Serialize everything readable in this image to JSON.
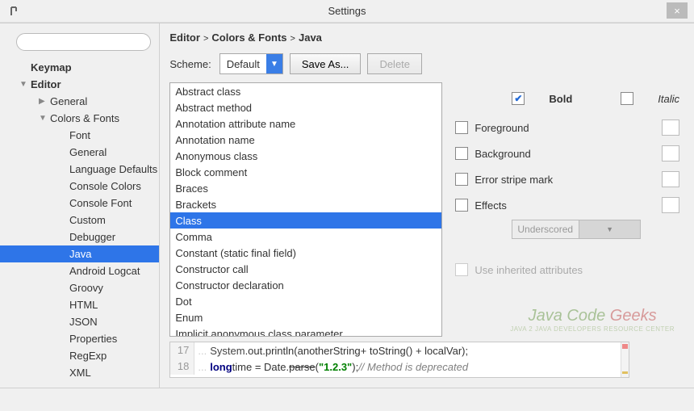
{
  "window": {
    "title": "Settings"
  },
  "search": {
    "placeholder": ""
  },
  "tree": [
    {
      "label": "Keymap",
      "level": 1,
      "bold": true,
      "caret": ""
    },
    {
      "label": "Editor",
      "level": 1,
      "bold": true,
      "caret": "▼"
    },
    {
      "label": "General",
      "level": 2,
      "caret": "▶"
    },
    {
      "label": "Colors & Fonts",
      "level": 2,
      "caret": "▼"
    },
    {
      "label": "Font",
      "level": 3
    },
    {
      "label": "General",
      "level": 3
    },
    {
      "label": "Language Defaults",
      "level": 3
    },
    {
      "label": "Console Colors",
      "level": 3
    },
    {
      "label": "Console Font",
      "level": 3
    },
    {
      "label": "Custom",
      "level": 3
    },
    {
      "label": "Debugger",
      "level": 3
    },
    {
      "label": "Java",
      "level": 3,
      "selected": true
    },
    {
      "label": "Android Logcat",
      "level": 3
    },
    {
      "label": "Groovy",
      "level": 3
    },
    {
      "label": "HTML",
      "level": 3
    },
    {
      "label": "JSON",
      "level": 3
    },
    {
      "label": "Properties",
      "level": 3
    },
    {
      "label": "RegExp",
      "level": 3
    },
    {
      "label": "XML",
      "level": 3
    }
  ],
  "breadcrumb": {
    "a": "Editor",
    "b": "Colors & Fonts",
    "c": "Java"
  },
  "scheme": {
    "label": "Scheme:",
    "value": "Default",
    "saveAs": "Save As...",
    "delete": "Delete"
  },
  "attributes": [
    "Abstract class",
    "Abstract method",
    "Annotation attribute name",
    "Annotation name",
    "Anonymous class",
    "Block comment",
    "Braces",
    "Brackets",
    "Class",
    "Comma",
    "Constant (static final field)",
    "Constructor call",
    "Constructor declaration",
    "Dot",
    "Enum",
    "Implicit anonymous class parameter"
  ],
  "attributes_selected_index": 8,
  "opts": {
    "bold": {
      "label": "Bold",
      "checked": true
    },
    "italic": {
      "label": "Italic",
      "checked": false
    },
    "foreground": {
      "label": "Foreground",
      "checked": false
    },
    "background": {
      "label": "Background",
      "checked": false
    },
    "errorStripe": {
      "label": "Error stripe mark",
      "checked": false
    },
    "effects": {
      "label": "Effects",
      "checked": false
    },
    "effectType": "Underscored",
    "inherit": {
      "label": "Use inherited attributes",
      "checked": false
    }
  },
  "code": {
    "line17_num": "17",
    "line17_a": "System",
    "line17_b": ".out.println(",
    "line17_c": "anotherString",
    "line17_d": " + toString() + localVar);",
    "line18_num": "18",
    "line18_kw": "long",
    "line18_a": " time = Date.",
    "line18_strike": "parse",
    "line18_b": "(",
    "line18_str": "\"1.2.3\"",
    "line18_c": "); ",
    "line18_cmt": "// Method is deprecated"
  },
  "watermark": {
    "main": "Java Code",
    "geeks": " Geeks",
    "sub": "JAVA 2 JAVA DEVELOPERS RESOURCE CENTER"
  }
}
